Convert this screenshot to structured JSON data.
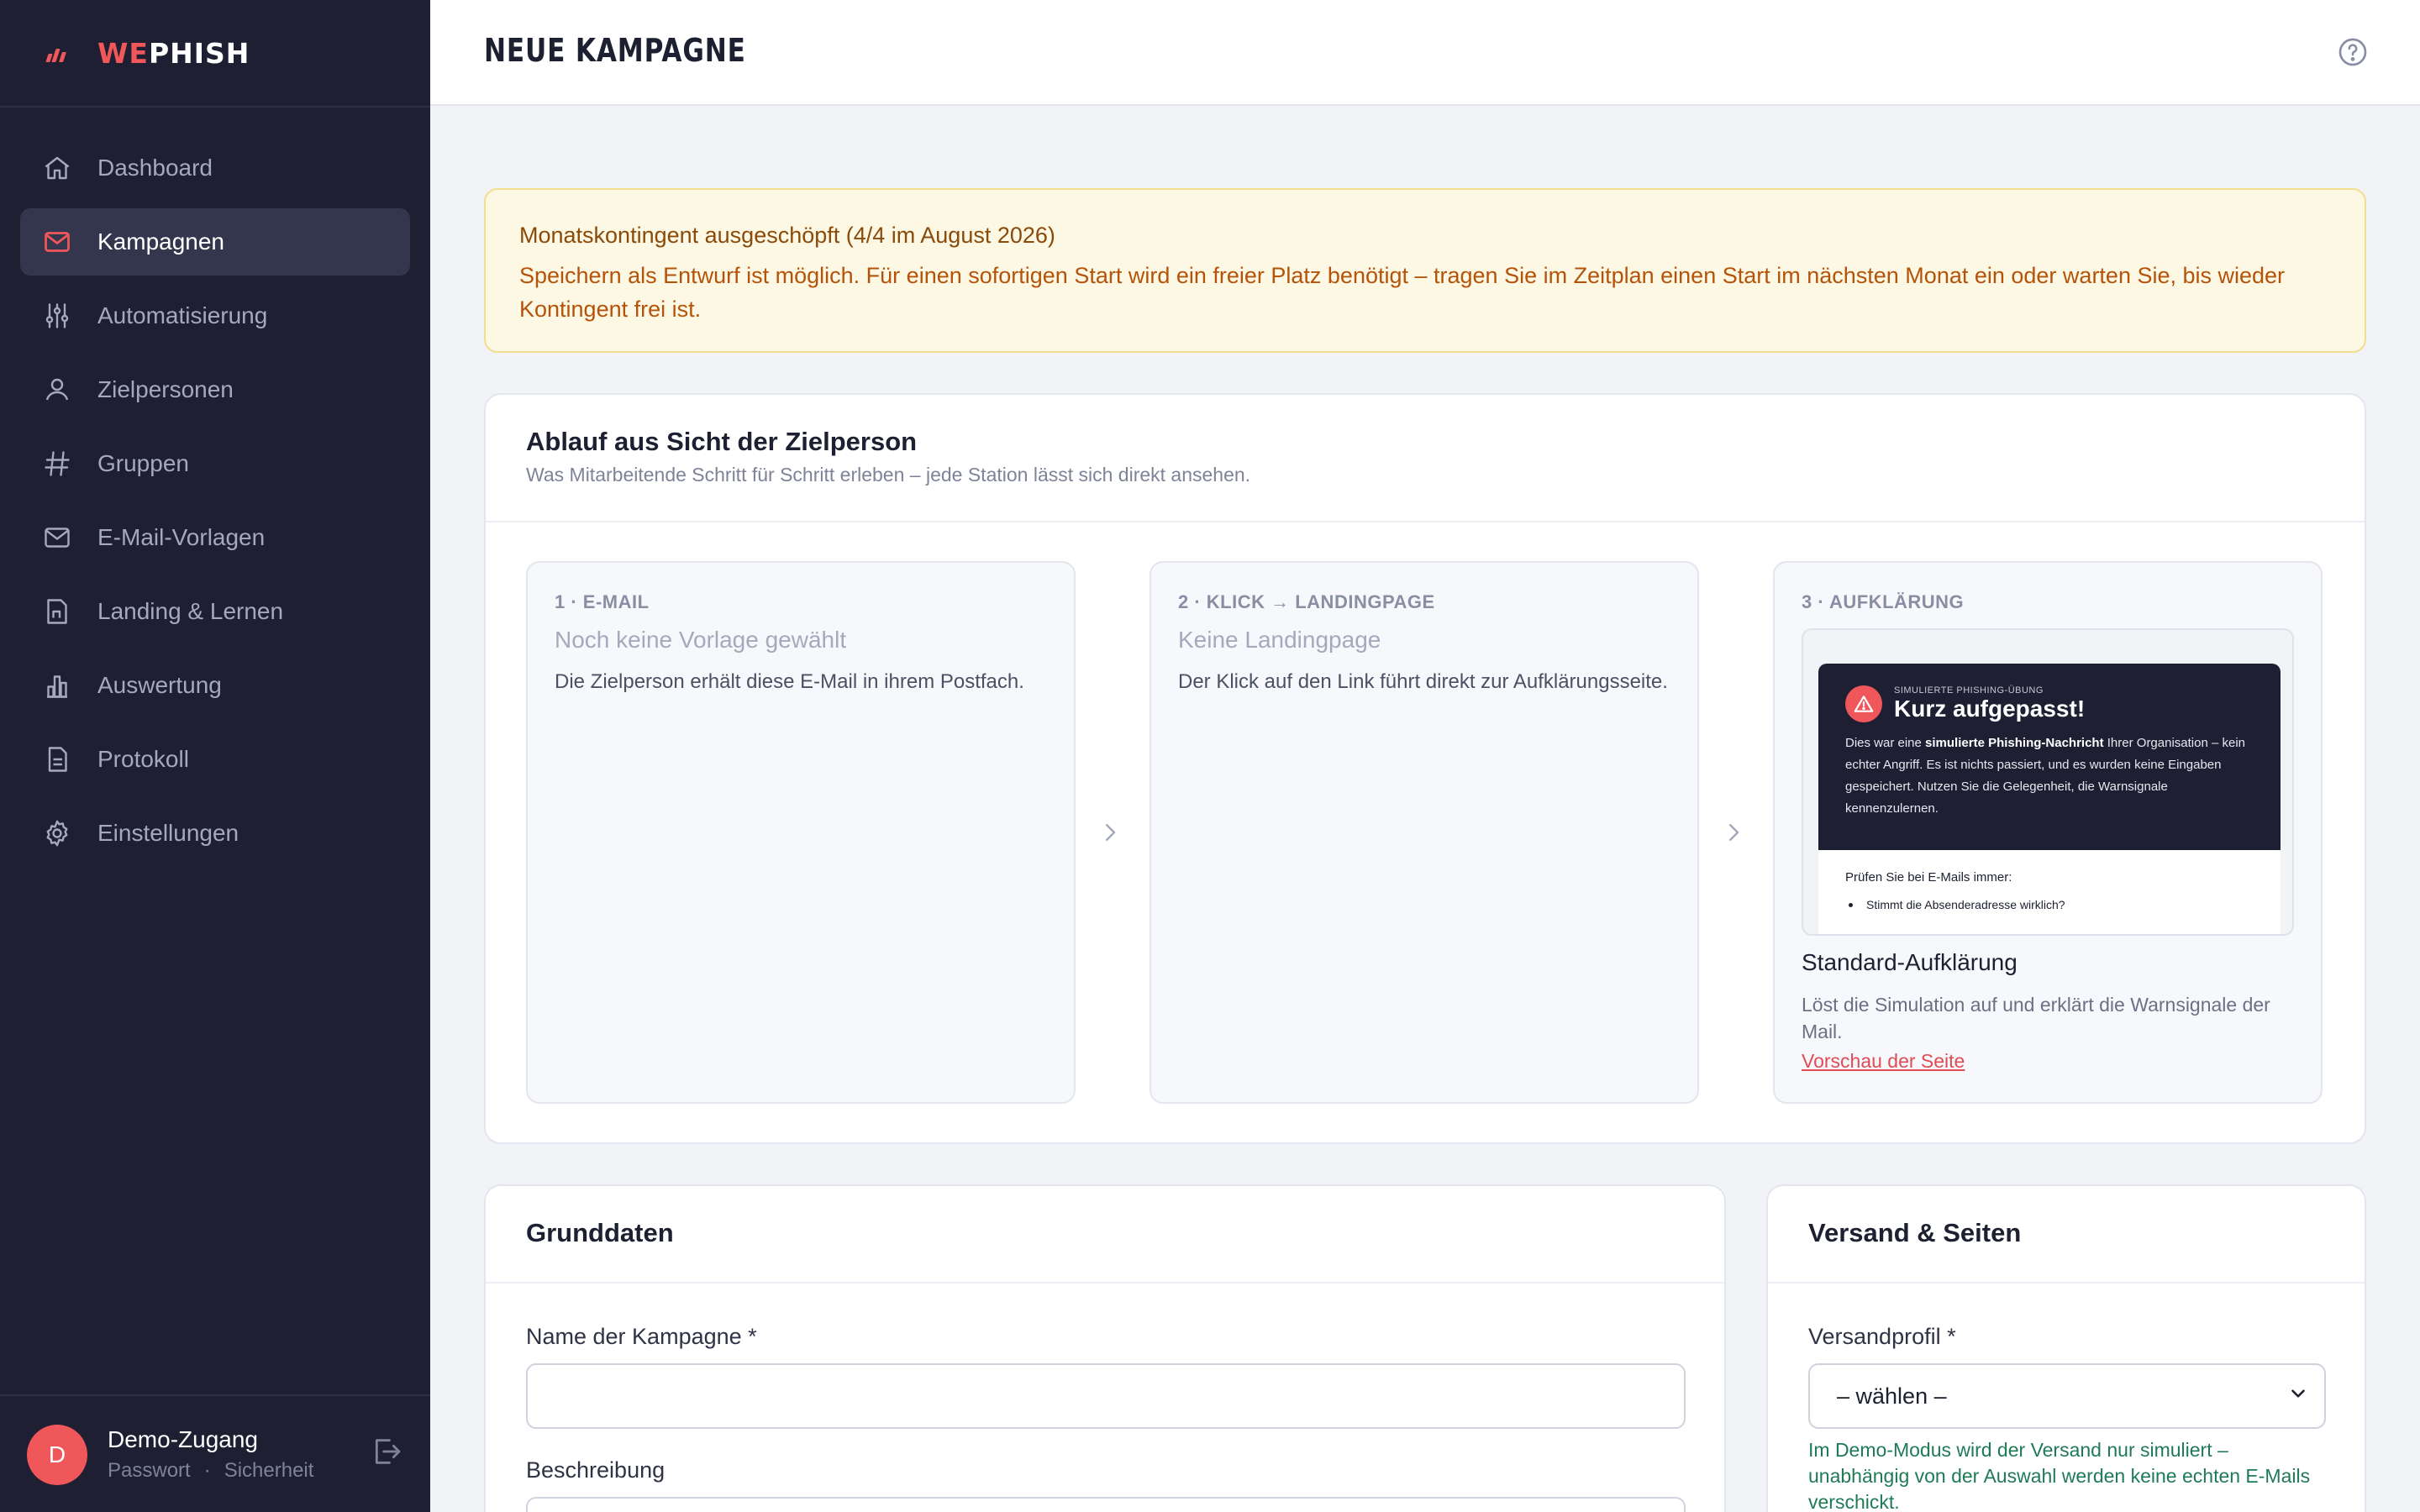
{
  "app": {
    "logo_we": "WE",
    "logo_phish": "PHISH"
  },
  "sidebar": {
    "items": [
      {
        "label": "Dashboard",
        "icon": "home-icon",
        "active": false
      },
      {
        "label": "Kampagnen",
        "icon": "mail-icon",
        "active": true
      },
      {
        "label": "Automatisierung",
        "icon": "sliders-icon",
        "active": false
      },
      {
        "label": "Zielpersonen",
        "icon": "user-icon",
        "active": false
      },
      {
        "label": "Gruppen",
        "icon": "hash-icon",
        "active": false
      },
      {
        "label": "E-Mail-Vorlagen",
        "icon": "envelope-icon",
        "active": false
      },
      {
        "label": "Landing & Lernen",
        "icon": "page-icon",
        "active": false
      },
      {
        "label": "Auswertung",
        "icon": "chart-icon",
        "active": false
      },
      {
        "label": "Protokoll",
        "icon": "document-icon",
        "active": false
      },
      {
        "label": "Einstellungen",
        "icon": "gear-icon",
        "active": false
      }
    ],
    "user": {
      "initial": "D",
      "name": "Demo-Zugang",
      "password_link": "Passwort",
      "separator": "·",
      "security_link": "Sicherheit"
    }
  },
  "header": {
    "title": "NEUE KAMPAGNE",
    "help_icon": "help-circle-icon"
  },
  "alert": {
    "title": "Monatskontingent ausgeschöpft (4/4 im August 2026)",
    "body": "Speichern als Entwurf ist möglich. Für einen sofortigen Start wird ein freier Platz benötigt – tragen Sie im Zeitplan einen Start im nächsten Monat ein oder warten Sie, bis wieder Kontingent frei ist."
  },
  "flow": {
    "title": "Ablauf aus Sicht der Zielperson",
    "subtitle": "Was Mitarbeitende Schritt für Schritt erleben – jede Station lässt sich direkt ansehen.",
    "steps": [
      {
        "label": "1 · E-MAIL",
        "name": "Noch keine Vorlage gewählt",
        "desc": "Die Zielperson erhält diese E-Mail in ihrem Postfach."
      },
      {
        "label": "2 · KLICK → LANDINGPAGE",
        "name": "Keine Landingpage",
        "desc": "Der Klick auf den Link führt direkt zur Aufklärungsseite."
      },
      {
        "label": "3 · AUFKLÄRUNG",
        "name": "Standard-Aufklärung",
        "desc": "Löst die Simulation auf und erklärt die Warnsignale der Mail.",
        "link": "Vorschau der Seite"
      }
    ],
    "preview": {
      "kicker": "SIMULIERTE PHISHING-ÜBUNG",
      "title": "Kurz aufgepasst!",
      "text_before": "Dies war eine ",
      "text_bold": "simulierte Phishing-Nachricht",
      "text_after": " Ihrer Organisation – kein echter Angriff. Es ist nichts passiert, und es wurden keine Eingaben gespeichert. Nutzen Sie die Gelegenheit, die Warnsignale kennenzulernen.",
      "check_title": "Prüfen Sie bei E-Mails immer:",
      "bullet": "Stimmt die Absenderadresse wirklich?"
    }
  },
  "basics": {
    "title": "Grunddaten",
    "name_label": "Name der Kampagne *",
    "name_value": "",
    "desc_label": "Beschreibung",
    "desc_value": ""
  },
  "send": {
    "title": "Versand & Seiten",
    "profile_label": "Versandprofil *",
    "profile_selected": "– wählen –",
    "hint": "Im Demo-Modus wird der Versand nur simuliert – unabhängig von der Auswahl werden keine echten E-Mails verschickt."
  },
  "colors": {
    "accent": "#f0575a",
    "sidebar_bg": "#1e1f33",
    "warning_bg": "#fdf8e4",
    "success_text": "#1f7a57"
  }
}
